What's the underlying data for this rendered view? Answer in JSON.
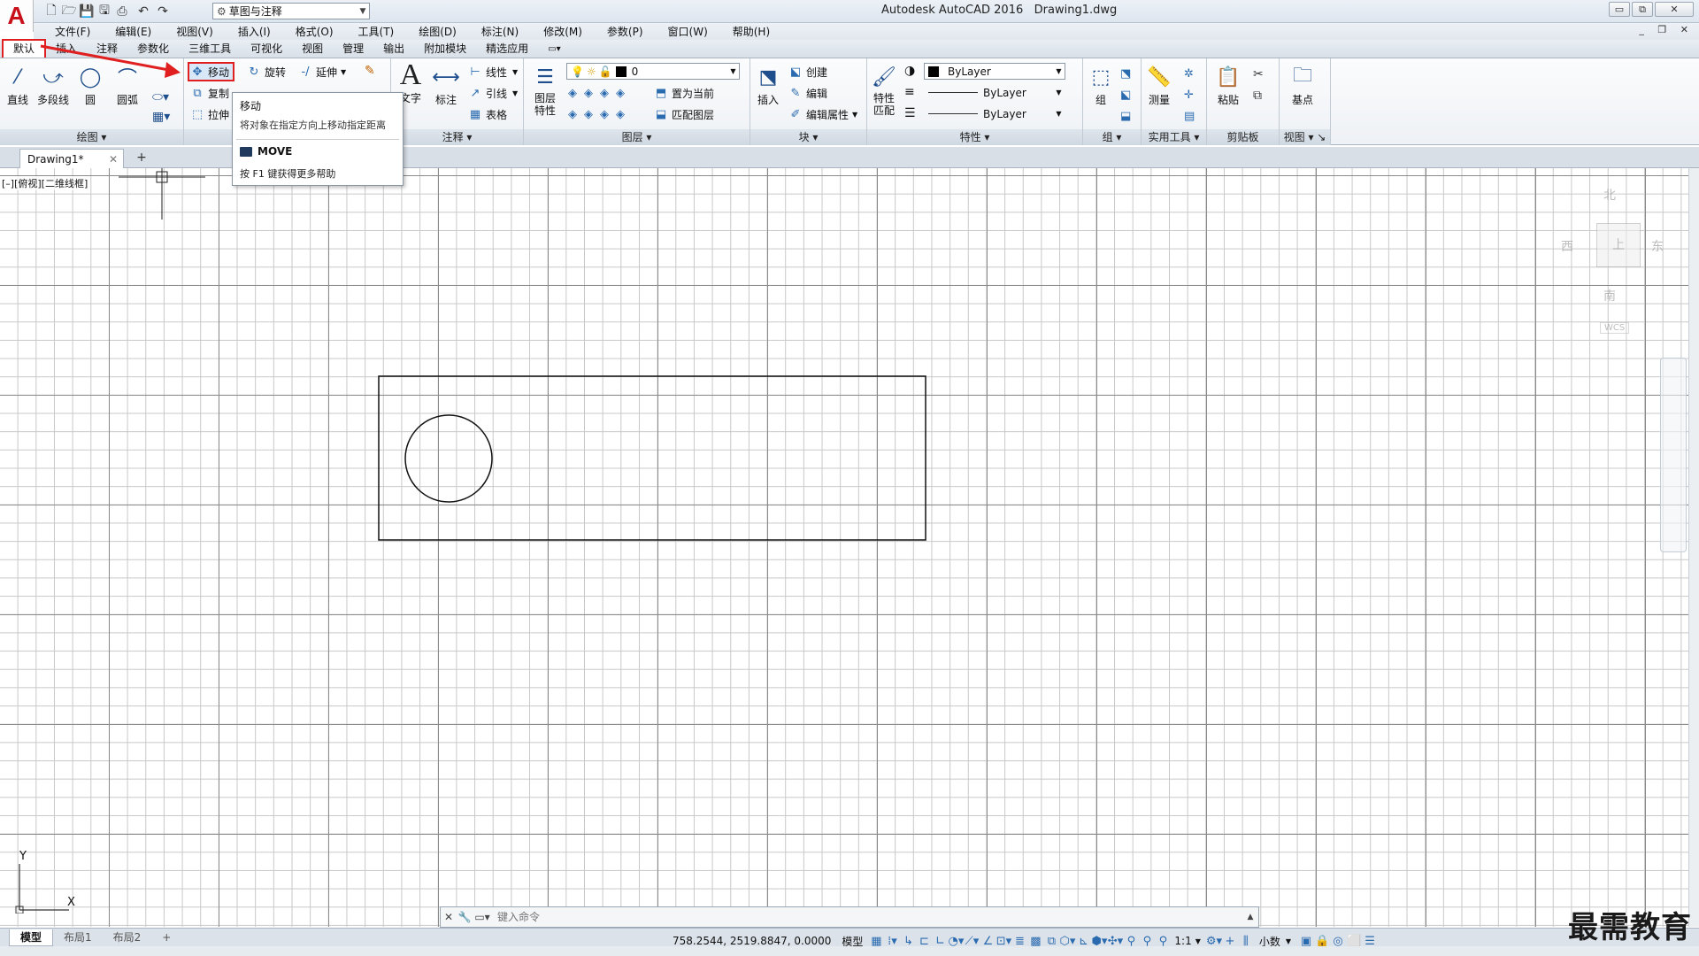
{
  "app": {
    "title": "Autodesk AutoCAD 2016",
    "filename": "Drawing1.dwg",
    "logo_letter": "A",
    "workspace": "草图与注释"
  },
  "window_buttons": {
    "minimize": "▭",
    "restore": "⧉",
    "close": "✕"
  },
  "mdi_controls": "_ ❐ ✕",
  "menus": [
    "文件(F)",
    "编辑(E)",
    "视图(V)",
    "插入(I)",
    "格式(O)",
    "工具(T)",
    "绘图(D)",
    "标注(N)",
    "修改(M)",
    "参数(P)",
    "窗口(W)",
    "帮助(H)"
  ],
  "ribbon_tabs": [
    "默认",
    "插入",
    "注释",
    "参数化",
    "三维工具",
    "可视化",
    "视图",
    "管理",
    "输出",
    "附加模块",
    "精选应用"
  ],
  "draw_panel": {
    "title": "绘图",
    "line": "直线",
    "polyline": "多段线",
    "circle": "圆",
    "arc": "圆弧"
  },
  "modify_panel": {
    "move": "移动",
    "rotate": "旋转",
    "extend": "延伸",
    "copy": "复制",
    "stretch": "拉伸"
  },
  "annotation_panel": {
    "title": "注释",
    "text": "文字",
    "dimension": "标注",
    "linear": "线性",
    "leader": "引线",
    "table": "表格"
  },
  "layers_panel": {
    "title": "图层",
    "layer_props": "图层特性",
    "current_layer": "0",
    "set_current": "置为当前",
    "match_layer": "匹配图层"
  },
  "block_panel": {
    "title": "块",
    "insert": "插入",
    "create": "创建",
    "edit": "编辑",
    "edit_attr": "编辑属性"
  },
  "properties_panel": {
    "title": "特性",
    "match": "特性匹配",
    "color": "ByLayer",
    "linetype": "ByLayer",
    "lineweight": "ByLayer"
  },
  "group_panel": {
    "title": "组",
    "group": "组"
  },
  "utilities_panel": {
    "title": "实用工具",
    "measure": "测量"
  },
  "clipboard_panel": {
    "title": "剪贴板",
    "paste": "粘贴"
  },
  "view_panel": {
    "title": "视图",
    "base": "基点"
  },
  "tooltip": {
    "title": "移动",
    "description": "将对象在指定方向上移动指定距离",
    "command": "MOVE",
    "help": "按 F1 键获得更多帮助"
  },
  "document_tab": "Drawing1*",
  "viewport_label": "[–][俯视][二维线框]",
  "viewcube": {
    "north": "北",
    "south": "南",
    "east": "东",
    "west": "西",
    "top": "上",
    "wcs": "WCS"
  },
  "ucs": {
    "x": "X",
    "y": "Y"
  },
  "command_line": {
    "placeholder": "键入命令"
  },
  "layout_tabs": [
    "模型",
    "布局1",
    "布局2"
  ],
  "status": {
    "coordinates": "758.2544, 2519.8847, 0.0000",
    "model": "模型",
    "scale": "1:1",
    "units": "小数"
  },
  "watermark": "最需教育",
  "colors": {
    "accent_red": "#e02020",
    "layer_color": "#000000"
  }
}
